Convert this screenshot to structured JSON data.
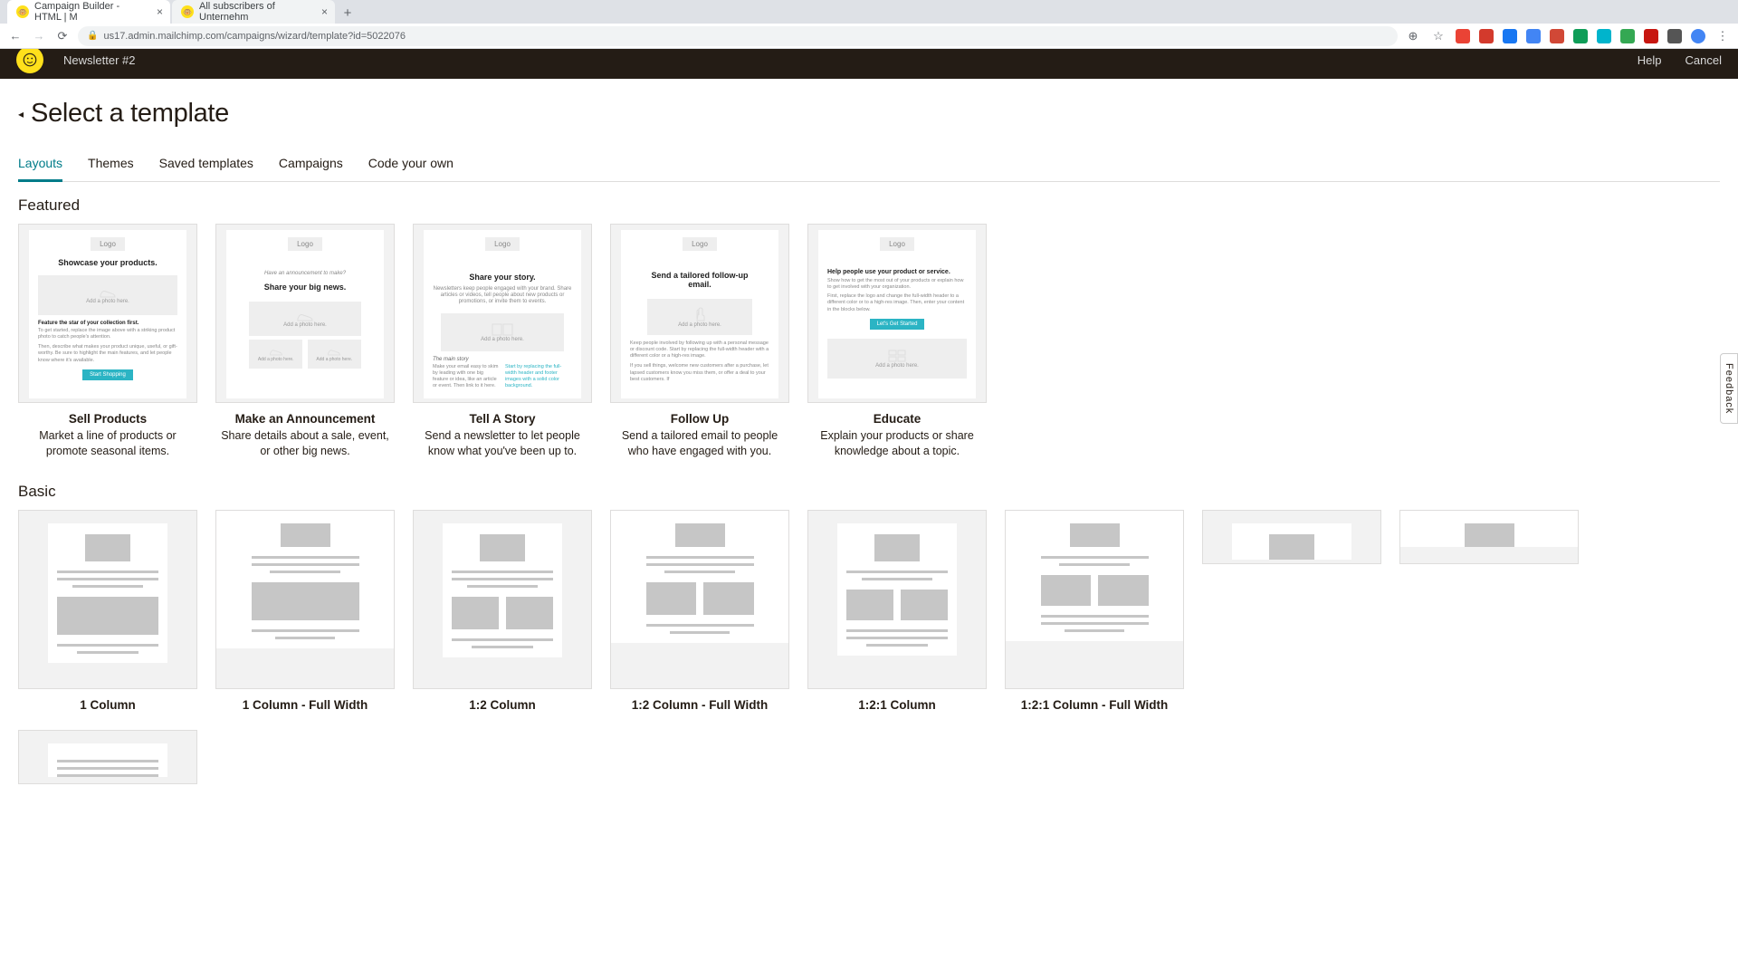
{
  "browser": {
    "tabs": [
      {
        "title": "Campaign Builder - HTML | M"
      },
      {
        "title": "All subscribers of Unternehm"
      }
    ],
    "url": "us17.admin.mailchimp.com/campaigns/wizard/template?id=5022076"
  },
  "header": {
    "campaign_name": "Newsletter #2",
    "help": "Help",
    "cancel": "Cancel"
  },
  "page": {
    "title": "Select a template",
    "tabs": [
      "Layouts",
      "Themes",
      "Saved templates",
      "Campaigns",
      "Code your own"
    ],
    "active_tab": 0
  },
  "featured": {
    "heading": "Featured",
    "items": [
      {
        "title": "Sell Products",
        "desc": "Market a line of products or promote seasonal items.",
        "logo": "Logo",
        "hd": "Showcase your products.",
        "photo": "Add a photo here.",
        "l1": "Feature the star of your collection first.",
        "l2": "To get started, replace the image above with a striking product photo to catch people's attention.",
        "l3": "Then, describe what makes your product unique, useful, or gift-worthy. Be sure to highlight the main features, and let people know where it's available.",
        "btn": "Start Shopping"
      },
      {
        "title": "Make an Announcement",
        "desc": "Share details about a sale, event, or other big news.",
        "logo": "Logo",
        "sub": "Have an announcement to make?",
        "hd": "Share your big news.",
        "photo": "Add a photo here.",
        "photo2": "Add a photo here."
      },
      {
        "title": "Tell A Story",
        "desc": "Send a newsletter to let people know what you've been up to.",
        "logo": "Logo",
        "hd": "Share your story.",
        "sub": "Newsletters keep people engaged with your brand. Share articles or videos, tell people about new products or promotions, or invite them to events.",
        "photo": "Add a photo here.",
        "l1": "The main story",
        "l2": "Make your email easy to skim by leading with one big feature or idea, like an article or event. Then link to it here.",
        "l3": "Start by replacing the full-width header and footer images with a solid color background."
      },
      {
        "title": "Follow Up",
        "desc": "Send a tailored email to people who have engaged with you.",
        "logo": "Logo",
        "hd": "Send a tailored follow-up email.",
        "photo": "Add a photo here.",
        "l1": "Keep people involved by following up with a personal message or discount code. Start by replacing the full-width header with a different color or a high-res image.",
        "l2": "If you sell things, welcome new customers after a purchase, let lapsed customers know you miss them, or offer a deal to your best customers. If"
      },
      {
        "title": "Educate",
        "desc": "Explain your products or share knowledge about a topic.",
        "logo": "Logo",
        "hd": "Help people use your product or service.",
        "l1": "Show how to get the most out of your products or explain how to get involved with your organization.",
        "l2": "First, replace the logo and change the full-width header to a different color or to a high-res image. Then, enter your content in the blocks below.",
        "btn": "Let's Get Started",
        "photo": "Add a photo here."
      }
    ]
  },
  "basic": {
    "heading": "Basic",
    "items": [
      {
        "title": "1 Column"
      },
      {
        "title": "1 Column - Full Width"
      },
      {
        "title": "1:2 Column"
      },
      {
        "title": "1:2 Column - Full Width"
      },
      {
        "title": "1:2:1 Column"
      },
      {
        "title": "1:2:1 Column - Full Width"
      }
    ]
  },
  "feedback": "Feedback"
}
